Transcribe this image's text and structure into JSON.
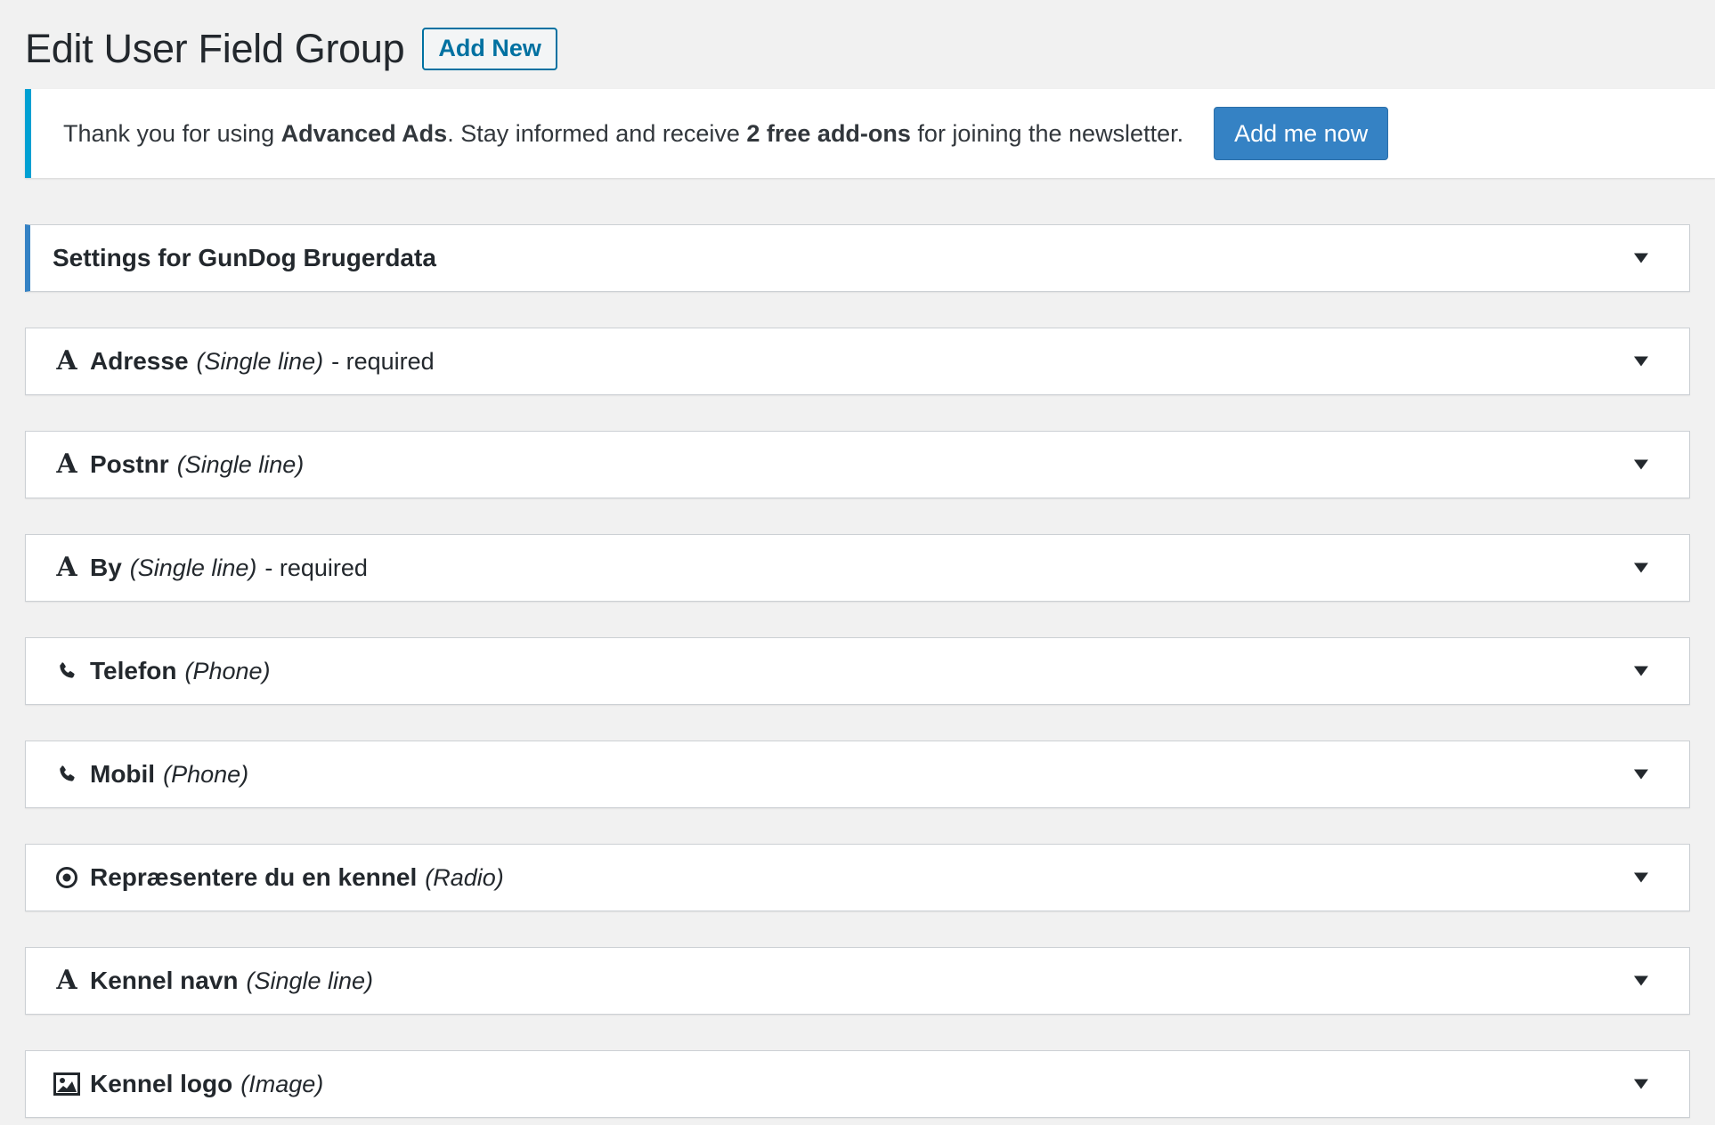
{
  "header": {
    "title": "Edit User Field Group",
    "add_new_label": "Add New"
  },
  "notice": {
    "text_before": "Thank you for using ",
    "brand": "Advanced Ads",
    "text_middle": ". Stay informed and receive ",
    "highlight": "2 free add-ons",
    "text_after": " for joining the newsletter.",
    "button_label": "Add me now"
  },
  "settings_panel": {
    "title": "Settings for GunDog Brugerdata"
  },
  "fields": [
    {
      "icon": "text-icon",
      "label": "Adresse",
      "type": "(Single line)",
      "required": "- required"
    },
    {
      "icon": "text-icon",
      "label": "Postnr",
      "type": "(Single line)",
      "required": ""
    },
    {
      "icon": "text-icon",
      "label": "By",
      "type": "(Single line)",
      "required": "- required"
    },
    {
      "icon": "phone-icon",
      "label": "Telefon",
      "type": "(Phone)",
      "required": ""
    },
    {
      "icon": "phone-icon",
      "label": "Mobil",
      "type": "(Phone)",
      "required": ""
    },
    {
      "icon": "radio-icon",
      "label": "Repræsentere du en kennel",
      "type": "(Radio)",
      "required": ""
    },
    {
      "icon": "text-icon",
      "label": "Kennel navn",
      "type": "(Single line)",
      "required": ""
    },
    {
      "icon": "image-icon",
      "label": "Kennel logo",
      "type": "(Image)",
      "required": ""
    }
  ],
  "colors": {
    "background": "#f1f1f1",
    "accent": "#3582c4",
    "notice_border": "#00a0d2",
    "text": "#23282d"
  }
}
